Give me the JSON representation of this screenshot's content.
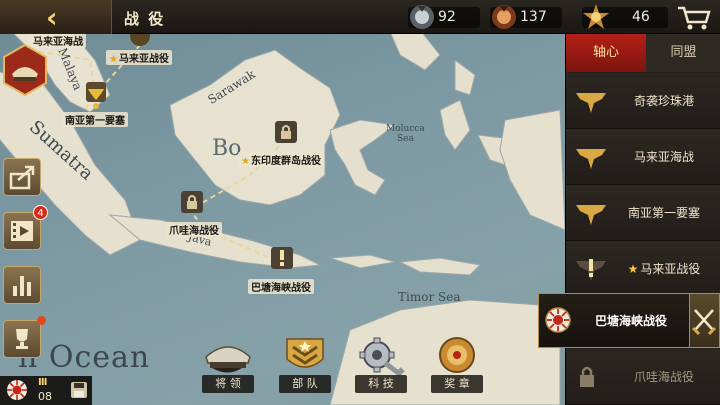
{
  "header": {
    "title": "战 役",
    "resources": [
      {
        "name": "medal",
        "value": "92"
      },
      {
        "name": "bronze-medal",
        "value": "137"
      },
      {
        "name": "honor-star",
        "value": "46"
      }
    ]
  },
  "map": {
    "labels": {
      "malaya": "Malaya",
      "sumatra": "Sumatra",
      "sarawak": "Sarawak",
      "borneo": "Bo",
      "molucca_sea": "Molucca\nSea",
      "java": "Java",
      "timor_sea": "Timor Sea",
      "ocean": "n Ocean"
    },
    "battles": [
      {
        "label": "马来亚海战"
      },
      {
        "label": "马来亚战役",
        "star": "★"
      },
      {
        "label": "南亚第一要塞"
      },
      {
        "label": "东印度群岛战役",
        "star": "★"
      },
      {
        "label": "爪哇海战役"
      },
      {
        "label": "巴塘海峡战役"
      }
    ]
  },
  "panel": {
    "tabs": [
      "轴心",
      "同盟"
    ],
    "campaigns": [
      {
        "name": "奇袭珍珠港"
      },
      {
        "name": "马来亚海战"
      },
      {
        "name": "南亚第一要塞"
      },
      {
        "name": "马来亚战役",
        "star": "★"
      }
    ],
    "active": {
      "name": "巴塘海峡战役"
    },
    "locked": {
      "name": "爪哇海战役"
    }
  },
  "sidebar": {
    "video_badge": "4"
  },
  "nav": [
    {
      "label": "将 领"
    },
    {
      "label": "部 队"
    },
    {
      "label": "科 技"
    },
    {
      "label": "奖 章"
    }
  ],
  "player": {
    "rank": "Ⅲ",
    "level": "08"
  },
  "colors": {
    "accent_red": "#b32016",
    "gold": "#f5d37a",
    "sea": "#7d99a3",
    "land": "#e6e0cf"
  }
}
